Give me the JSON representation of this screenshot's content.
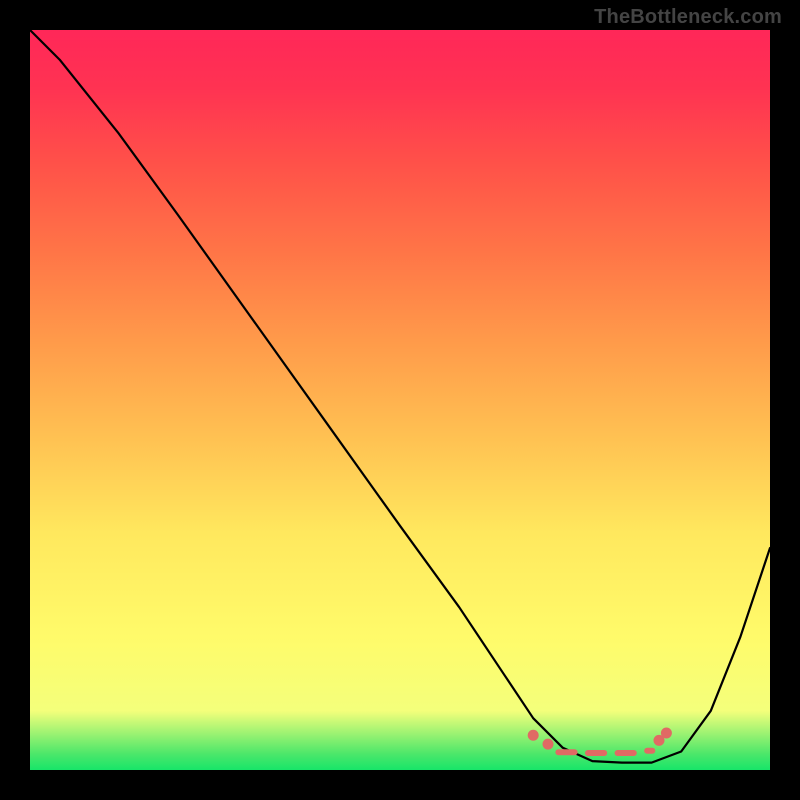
{
  "watermark": "TheBottleneck.com",
  "domain_note": "bottleneck curve chart",
  "chart_data": {
    "type": "line",
    "title": "",
    "xlabel": "",
    "ylabel": "",
    "xlim": [
      0,
      100
    ],
    "ylim": [
      0,
      100
    ],
    "grid": false,
    "legend": false,
    "background_gradient": {
      "orientation": "vertical",
      "stops": [
        {
          "pct": 0,
          "color": "#17e569"
        },
        {
          "pct": 2.2,
          "color": "#4de76a"
        },
        {
          "pct": 8,
          "color": "#f4ff7b"
        },
        {
          "pct": 18,
          "color": "#fffb6a"
        },
        {
          "pct": 32,
          "color": "#ffe85e"
        },
        {
          "pct": 45,
          "color": "#ffc152"
        },
        {
          "pct": 58,
          "color": "#ff9a4a"
        },
        {
          "pct": 70,
          "color": "#ff7547"
        },
        {
          "pct": 82,
          "color": "#ff5149"
        },
        {
          "pct": 92,
          "color": "#ff3352"
        },
        {
          "pct": 100,
          "color": "#ff2758"
        }
      ]
    },
    "series": [
      {
        "name": "bottleneck-curve",
        "color": "#000000",
        "x": [
          0,
          4,
          12,
          20,
          30,
          40,
          50,
          58,
          64,
          68,
          72,
          76,
          80,
          84,
          88,
          92,
          96,
          100
        ],
        "y": [
          100,
          96,
          86,
          75,
          61,
          47,
          33,
          22,
          13,
          7,
          3,
          1.2,
          1.0,
          1.0,
          2.5,
          8,
          18,
          30
        ]
      }
    ],
    "markers": {
      "name": "valley-highlight",
      "color": "#e06a64",
      "points": [
        {
          "x": 68,
          "y": 4.7
        },
        {
          "x": 70,
          "y": 3.5
        },
        {
          "x": 85,
          "y": 4.0
        },
        {
          "x": 86,
          "y": 5.0
        }
      ],
      "dashes": [
        {
          "x0": 71,
          "x1": 74,
          "y": 2.4
        },
        {
          "x0": 75,
          "x1": 78,
          "y": 2.3
        },
        {
          "x0": 79,
          "x1": 82,
          "y": 2.3
        },
        {
          "x0": 83,
          "x1": 84.5,
          "y": 2.6
        }
      ]
    }
  }
}
